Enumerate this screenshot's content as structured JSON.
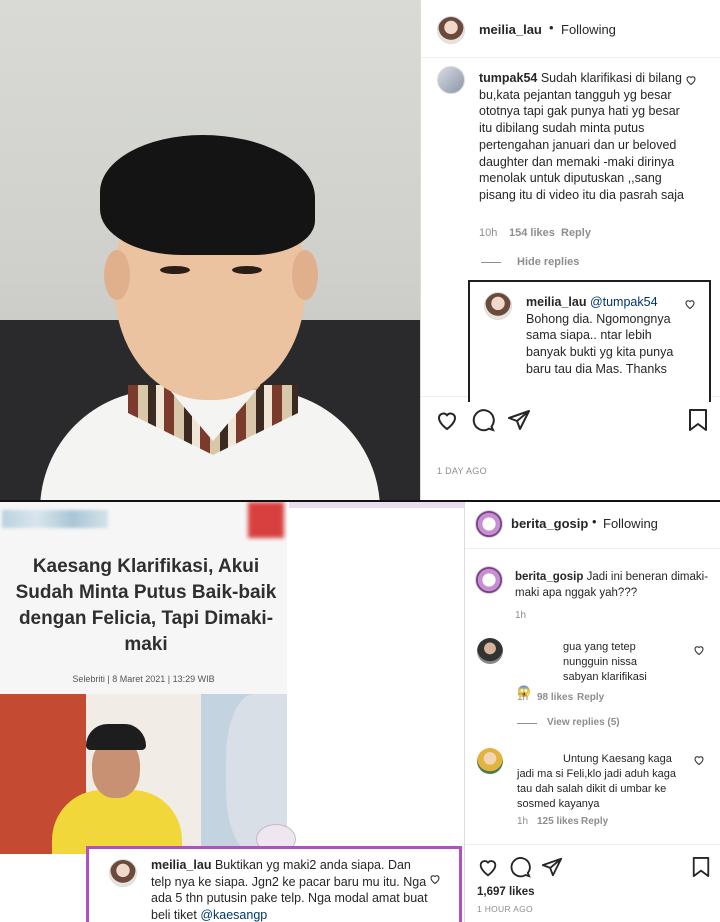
{
  "top_post": {
    "username": "meilia_lau",
    "follow_status": "Following",
    "comment": {
      "username": "tumpak54",
      "text": "Sudah klarifikasi di bilang bu,kata pejantan tangguh yg besar ototnya tapi gak punya hati yg besar itu dibilang sudah minta putus pertengahan januari dan ur beloved daughter dan memaki -maki dirinya menolak untuk diputuskan ,,sang pisang itu di video itu dia pasrah saja",
      "time": "10h",
      "likes": "154 likes",
      "reply": "Reply",
      "hide_replies": "Hide replies"
    },
    "reply": {
      "username": "meilia_lau",
      "mention": "@tumpak54",
      "text": "Bohong dia. Ngomongnya sama siapa.. ntar lebih banyak bukti yg kita punya baru tau dia Mas. Thanks"
    },
    "timestamp": "1 DAY AGO"
  },
  "article": {
    "headline": "Kaesang Klarifikasi, Akui Sudah Minta Putus Baik-baik dengan Felicia, Tapi Dimaki-maki",
    "category": "Selebriti",
    "date": "8 Maret 2021",
    "time": "13:29 WIB",
    "highlight_comment": {
      "username": "meilia_lau",
      "text": "Buktikan yg maki2 anda siapa. Dan telp nya ke siapa. Jgn2 ke pacar baru mu itu. Nga ada 5 thn putusin pake telp. Nga modal amat buat beli tiket",
      "mention": "@kaesangp"
    }
  },
  "bottom_post": {
    "username": "berita_gosip",
    "follow_status": "Following",
    "caption": {
      "username": "berita_gosip",
      "text": "Jadi ini beneran dimaki-maki apa nggak yah???",
      "time": "1h"
    },
    "comments": [
      {
        "text": "gua yang tetep nungguin nissa sabyan klarifikasi",
        "emoji": "😱",
        "time": "1h",
        "likes": "98 likes",
        "reply": "Reply",
        "view_replies": "View replies (5)"
      },
      {
        "text": "Untung Kaesang kaga jadi ma si Feli,klo jadi aduh kaga tau dah salah dikit di umbar ke sosmed kayanya",
        "time": "1h",
        "likes": "125 likes",
        "reply": "Reply"
      }
    ],
    "likes": "1,697 likes",
    "timestamp": "1 HOUR AGO"
  },
  "colors": {
    "highlight_border": "#b24fc5",
    "muted": "#8e8e8e",
    "text": "#262626"
  }
}
